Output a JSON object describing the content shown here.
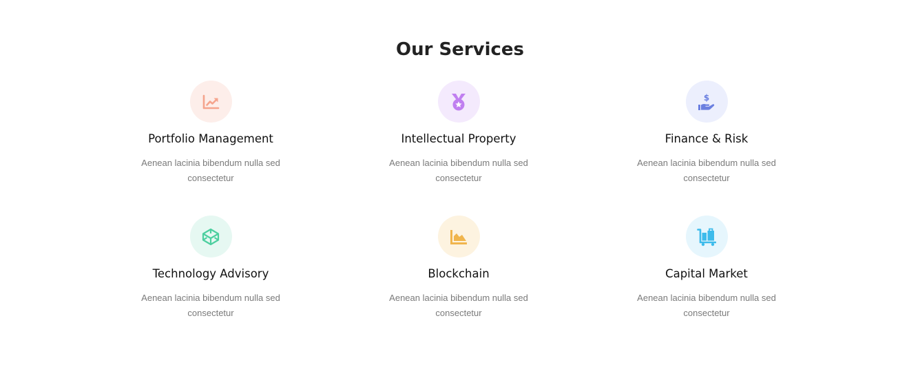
{
  "section": {
    "title": "Our Services"
  },
  "services": [
    {
      "title": "Portfolio Management",
      "description": "Aenean lacinia bibendum nulla sed consectetur",
      "icon": "chart-line-up-icon",
      "icon_color": "#f5a48d",
      "circle_color": "#fdeeea"
    },
    {
      "title": "Intellectual Property",
      "description": "Aenean lacinia bibendum nulla sed consectetur",
      "icon": "medal-icon",
      "icon_color": "#c07ff0",
      "circle_color": "#f4eafd"
    },
    {
      "title": "Finance & Risk",
      "description": "Aenean lacinia bibendum nulla sed consectetur",
      "icon": "hand-holding-dollar-icon",
      "icon_color": "#6a7fe0",
      "circle_color": "#eceffd"
    },
    {
      "title": "Technology Advisory",
      "description": "Aenean lacinia bibendum nulla sed consectetur",
      "icon": "cube-icon",
      "icon_color": "#4ccf9f",
      "circle_color": "#e6f8f2"
    },
    {
      "title": "Blockchain",
      "description": "Aenean lacinia bibendum nulla sed consectetur",
      "icon": "chart-area-icon",
      "icon_color": "#f0b54d",
      "circle_color": "#fdf3e0"
    },
    {
      "title": "Capital Market",
      "description": "Aenean lacinia bibendum nulla sed consectetur",
      "icon": "luggage-cart-icon",
      "icon_color": "#3dbbeb",
      "circle_color": "#e6f6fd"
    }
  ]
}
